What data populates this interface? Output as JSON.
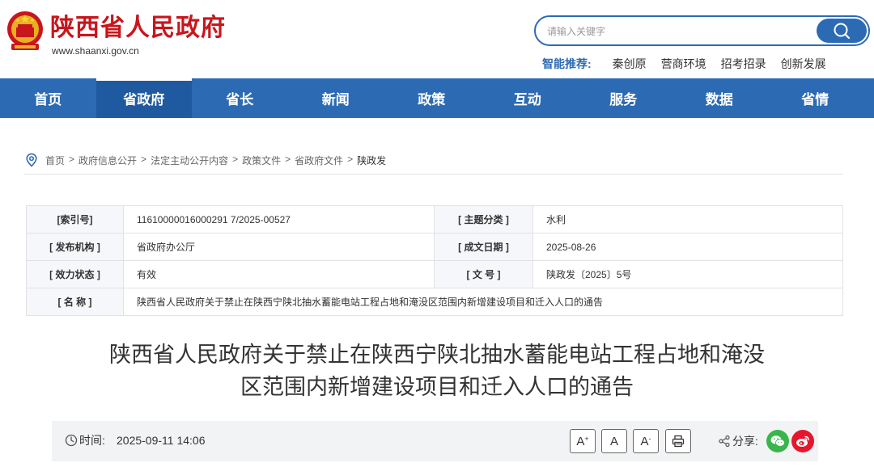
{
  "header": {
    "site_title": "陕西省人民政府",
    "site_url": "www.shaanxi.gov.cn",
    "search_placeholder": "请输入关键字",
    "recommend_label": "智能推荐:",
    "recommend_items": [
      "秦创原",
      "营商环境",
      "招考招录",
      "创新发展"
    ]
  },
  "nav": {
    "items": [
      "首页",
      "省政府",
      "省长",
      "新闻",
      "政策",
      "互动",
      "服务",
      "数据",
      "省情"
    ],
    "active": "省政府"
  },
  "breadcrumb": {
    "items": [
      "首页",
      "政府信息公开",
      "法定主动公开内容",
      "政策文件",
      "省政府文件"
    ],
    "current": "陕政发",
    "separator": ">"
  },
  "info": {
    "index_label": "[索引号]",
    "index_value": "11610000016000291 7/2025-00527",
    "topic_label": "[ 主题分类 ]",
    "topic_value": "水利",
    "publisher_label": "[ 发布机构 ]",
    "publisher_value": "省政府办公厅",
    "date_label": "[ 成文日期 ]",
    "date_value": "2025-08-26",
    "status_label": "[ 效力状态 ]",
    "status_value": "有效",
    "docno_label": "[ 文 号 ]",
    "docno_value": "陕政发〔2025〕5号",
    "name_label": "[ 名 称 ]",
    "name_value": "陕西省人民政府关于禁止在陕西宁陕北抽水蓄能电站工程占地和淹没区范围内新增建设项目和迁入人口的通告"
  },
  "article": {
    "title_line1": "陕西省人民政府关于禁止在陕西宁陕北抽水蓄能电站工程占地和淹没",
    "title_line2": "区范围内新增建设项目和迁入人口的通告",
    "time_label": "时间:",
    "time_value": "2025-09-11 14:06",
    "font_large": "A",
    "font_large_sup": "+",
    "font_medium": "A",
    "font_small": "A",
    "font_small_sup": "-",
    "share_label": "分享:"
  },
  "colors": {
    "brand_red": "#c8161d",
    "brand_blue": "#2c6bb3",
    "wechat_green": "#39b54a",
    "weibo_red": "#e6162d"
  }
}
